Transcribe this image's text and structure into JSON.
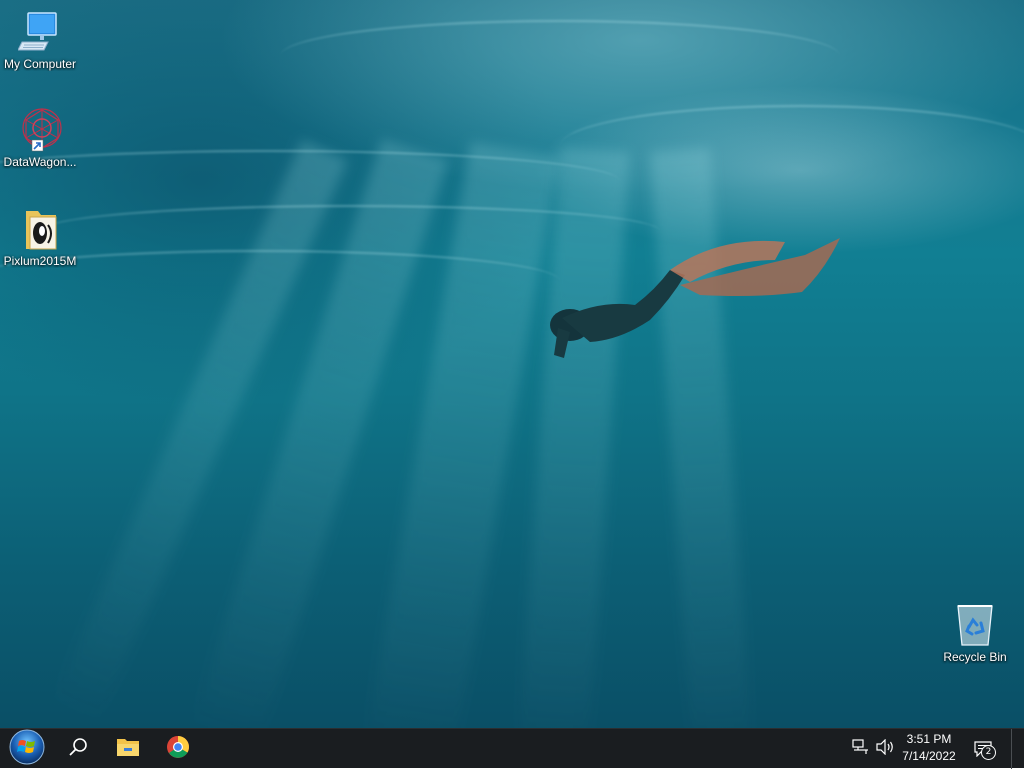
{
  "desktop": {
    "icons": [
      {
        "label": "My Computer",
        "icon": "computer-icon"
      },
      {
        "label": "DataWagon...",
        "icon": "datawagon-shortcut-icon"
      },
      {
        "label": "Pixlum2015M",
        "icon": "pixlum-folder-icon"
      },
      {
        "label": "Recycle Bin",
        "icon": "recycle-bin-icon"
      }
    ]
  },
  "taskbar": {
    "start": {
      "icon": "windows-start-orb-icon"
    },
    "pinned": [
      {
        "icon": "search-icon"
      },
      {
        "icon": "file-explorer-icon"
      },
      {
        "icon": "chrome-icon"
      }
    ],
    "tray": {
      "network_icon": "network-icon",
      "volume_icon": "volume-icon",
      "time": "3:51 PM",
      "date": "7/14/2022",
      "notifications_icon": "action-center-icon",
      "notifications_count": "2"
    }
  },
  "colors": {
    "taskbar_bg": "#1a1d20",
    "water_top": "#1b6f86",
    "water_bottom": "#0a4f66"
  }
}
